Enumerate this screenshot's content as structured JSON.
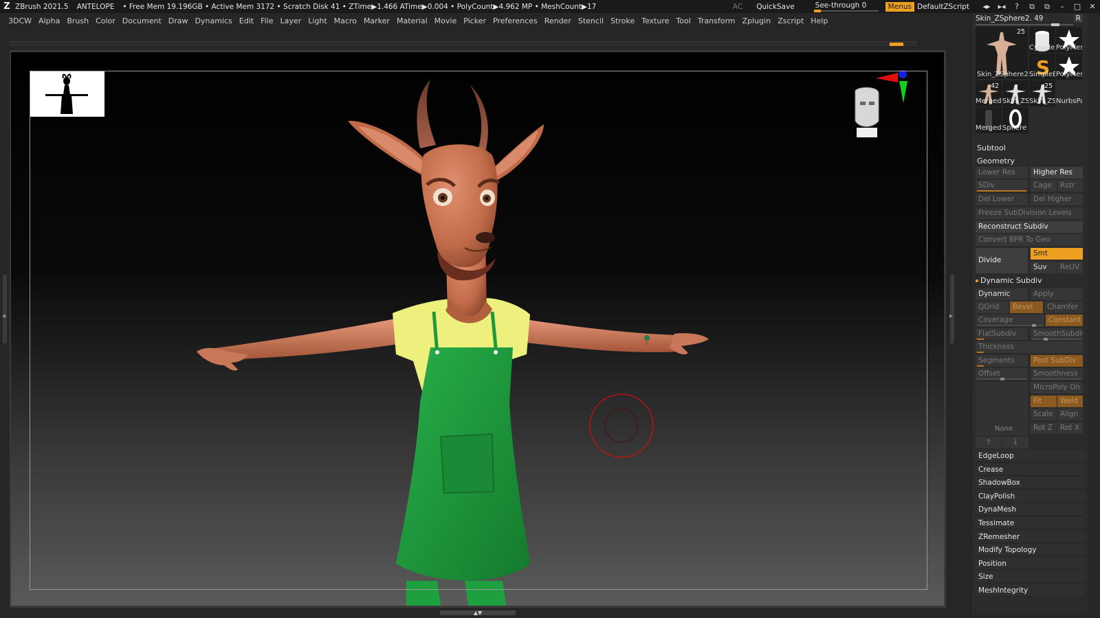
{
  "titlebar": {
    "app": "ZBrush 2021.5",
    "project": "ANTELOPE",
    "stats": "• Free Mem 19.196GB • Active Mem 3172 • Scratch Disk 41 •  ZTime▶1.466 ATime▶0.004 • PolyCount▶4.962 MP  • MeshCount▶17",
    "ac": "AC",
    "quicksave": "QuickSave",
    "seethrough": "See-through   0",
    "menus": "Menus",
    "script": "DefaultZScript",
    "window_controls": [
      "◂▸",
      "▸◂",
      "?",
      "⧉",
      "⧉",
      "–",
      "□",
      "✕"
    ]
  },
  "menu": [
    "3DCW",
    "Alpha",
    "Brush",
    "Color",
    "Document",
    "Draw",
    "Dynamics",
    "Edit",
    "File",
    "Layer",
    "Light",
    "Macro",
    "Marker",
    "Material",
    "Movie",
    "Picker",
    "Preferences",
    "Render",
    "Stencil",
    "Stroke",
    "Texture",
    "Tool",
    "Transform",
    "Zplugin",
    "Zscript",
    "Help"
  ],
  "tool_panel": {
    "current_tool": "Skin_ZSphere2. 49",
    "r_button": "R",
    "tools": [
      {
        "label": "Skin_ZSphere2",
        "num": "25"
      },
      {
        "label": "Cylinder",
        "num": ""
      },
      {
        "label": "PolyMes",
        "num": ""
      },
      {
        "label": "SimpleB",
        "num": ""
      },
      {
        "label": "PolyMes",
        "num": ""
      },
      {
        "label": "Merged",
        "num": "42"
      },
      {
        "label": "Skin_ZS",
        "num": ""
      },
      {
        "label": "Skin_ZS",
        "num": "25"
      },
      {
        "label": "NurbsPa",
        "num": ""
      },
      {
        "label": "Merged",
        "num": ""
      },
      {
        "label": "Sphere",
        "num": ""
      }
    ]
  },
  "subtool": "Subtool",
  "geometry": {
    "title": "Geometry",
    "lower_res": "Lower Res",
    "higher_res": "Higher Res",
    "sdiv": "SDiv",
    "cage": "Cage",
    "rstr": "Rstr",
    "del_lower": "Del Lower",
    "del_higher": "Del Higher",
    "freeze": "Freeze SubDivision Levels",
    "reconstruct": "Reconstruct Subdiv",
    "convert_bpr": "Convert BPR To Geo",
    "divide": "Divide",
    "smt": "Smt",
    "suv": "Suv",
    "reuv": "ReUV"
  },
  "dynamic_subdiv": {
    "title": "Dynamic Subdiv",
    "dynamic": "Dynamic",
    "apply": "Apply",
    "qgrid": "QGrid",
    "bevel": "Bevel",
    "chamfer": "Chamfer",
    "coverage": "Coverage",
    "constant": "Constant",
    "flatsubdiv": "FlatSubdiv",
    "smoothsubdiv": "SmoothSubdiv",
    "thickness": "Thickness",
    "segments": "Segments",
    "post_subdiv": "Post SubDiv",
    "offset": "Offset",
    "smoothness": "Smoothness",
    "micropoly_on": "MicroPoly On",
    "fit": "Fit",
    "weld": "Weld",
    "scale": "Scale",
    "align": "Align",
    "rot_z": "Rot Z",
    "rot_x": "Rot X",
    "none": "None",
    "arrow_up": "↑",
    "arrow_down": "↓"
  },
  "sections": [
    "EdgeLoop",
    "Crease",
    "ShadowBox",
    "ClayPolish",
    "DynaMesh",
    "Tessimate",
    "ZRemesher",
    "Modify Topology",
    "Position",
    "Size",
    "MeshIntegrity"
  ],
  "colors": {
    "accent": "#f0a020",
    "skin": "#c8704e",
    "apron": "#1f9a3a",
    "shirt": "#f0f080",
    "brush_ring": "#cc1010"
  },
  "icons": {
    "zbrush_logo": "Z",
    "navigation_head": "head-icon",
    "axis_gizmo": "axis-gizmo-icon",
    "brush_cursor": "brush-ring-icon"
  }
}
